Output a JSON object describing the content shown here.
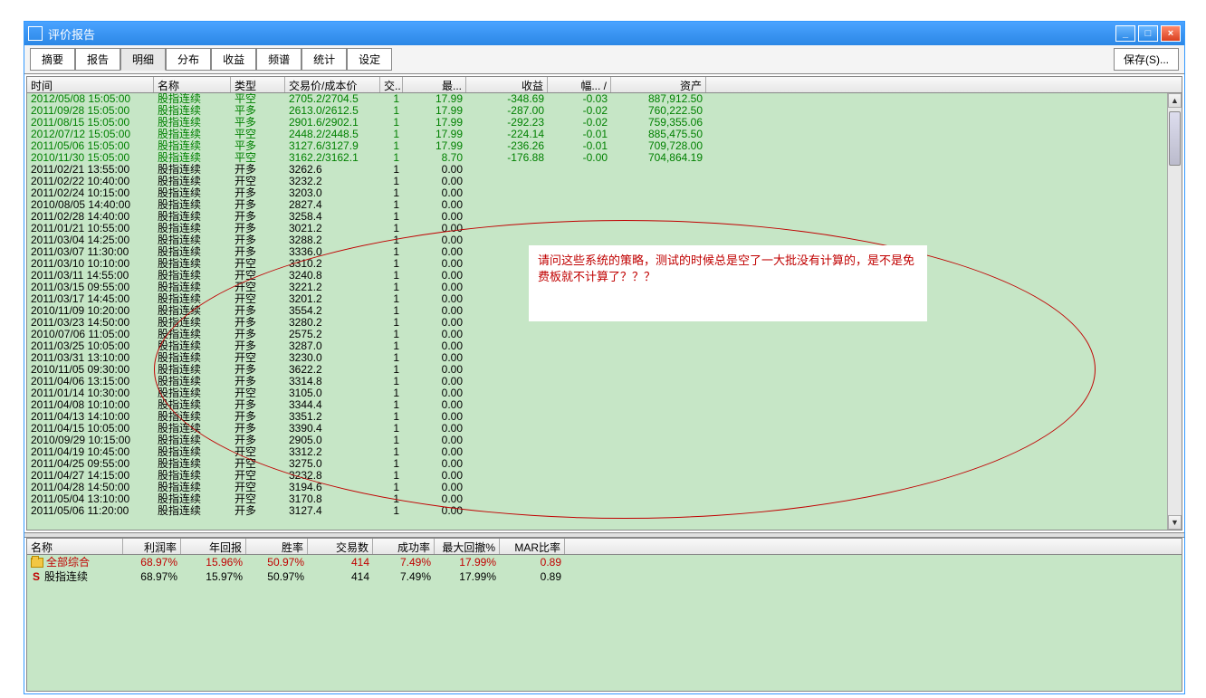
{
  "titlebar": {
    "title": "评价报告",
    "min": "_",
    "max": "□",
    "close": "×"
  },
  "toolbar": {
    "tabs": [
      "摘要",
      "报告",
      "明细",
      "分布",
      "收益",
      "频谱",
      "统计",
      "设定"
    ],
    "active_index": 2,
    "save_label": "保存(S)..."
  },
  "main_columns": [
    "时间",
    "名称",
    "类型",
    "交易价/成本价",
    "交..",
    "最...",
    "收益",
    "幅...  /",
    "资产"
  ],
  "main_rows": [
    {
      "g": 1,
      "t": "2012/05/08 15:05:00",
      "n": "股指连续",
      "ty": "平空",
      "p": "2705.2/2704.5",
      "q": "1",
      "a": "17.99",
      "pr": "-348.69",
      "r": "-0.03",
      "as": "887,912.50"
    },
    {
      "g": 1,
      "t": "2011/09/28 15:05:00",
      "n": "股指连续",
      "ty": "平多",
      "p": "2613.0/2612.5",
      "q": "1",
      "a": "17.99",
      "pr": "-287.00",
      "r": "-0.02",
      "as": "760,222.50"
    },
    {
      "g": 1,
      "t": "2011/08/15 15:05:00",
      "n": "股指连续",
      "ty": "平多",
      "p": "2901.6/2902.1",
      "q": "1",
      "a": "17.99",
      "pr": "-292.23",
      "r": "-0.02",
      "as": "759,355.06"
    },
    {
      "g": 1,
      "t": "2012/07/12 15:05:00",
      "n": "股指连续",
      "ty": "平空",
      "p": "2448.2/2448.5",
      "q": "1",
      "a": "17.99",
      "pr": "-224.14",
      "r": "-0.01",
      "as": "885,475.50"
    },
    {
      "g": 1,
      "t": "2011/05/06 15:05:00",
      "n": "股指连续",
      "ty": "平多",
      "p": "3127.6/3127.9",
      "q": "1",
      "a": "17.99",
      "pr": "-236.26",
      "r": "-0.01",
      "as": "709,728.00"
    },
    {
      "g": 1,
      "t": "2010/11/30 15:05:00",
      "n": "股指连续",
      "ty": "平空",
      "p": "3162.2/3162.1",
      "q": "1",
      "a": "8.70",
      "pr": "-176.88",
      "r": "-0.00",
      "as": "704,864.19"
    },
    {
      "g": 0,
      "t": "2011/02/21 13:55:00",
      "n": "股指连续",
      "ty": "开多",
      "p": "3262.6",
      "q": "1",
      "a": "0.00",
      "pr": "",
      "r": "",
      "as": ""
    },
    {
      "g": 0,
      "t": "2011/02/22 10:40:00",
      "n": "股指连续",
      "ty": "开空",
      "p": "3232.2",
      "q": "1",
      "a": "0.00",
      "pr": "",
      "r": "",
      "as": ""
    },
    {
      "g": 0,
      "t": "2011/02/24 10:15:00",
      "n": "股指连续",
      "ty": "开多",
      "p": "3203.0",
      "q": "1",
      "a": "0.00",
      "pr": "",
      "r": "",
      "as": ""
    },
    {
      "g": 0,
      "t": "2010/08/05 14:40:00",
      "n": "股指连续",
      "ty": "开多",
      "p": "2827.4",
      "q": "1",
      "a": "0.00",
      "pr": "",
      "r": "",
      "as": ""
    },
    {
      "g": 0,
      "t": "2011/02/28 14:40:00",
      "n": "股指连续",
      "ty": "开多",
      "p": "3258.4",
      "q": "1",
      "a": "0.00",
      "pr": "",
      "r": "",
      "as": ""
    },
    {
      "g": 0,
      "t": "2011/01/21 10:55:00",
      "n": "股指连续",
      "ty": "开多",
      "p": "3021.2",
      "q": "1",
      "a": "0.00",
      "pr": "",
      "r": "",
      "as": ""
    },
    {
      "g": 0,
      "t": "2011/03/04 14:25:00",
      "n": "股指连续",
      "ty": "开多",
      "p": "3288.2",
      "q": "1",
      "a": "0.00",
      "pr": "",
      "r": "",
      "as": ""
    },
    {
      "g": 0,
      "t": "2011/03/07 11:30:00",
      "n": "股指连续",
      "ty": "开多",
      "p": "3336.0",
      "q": "1",
      "a": "0.00",
      "pr": "",
      "r": "",
      "as": ""
    },
    {
      "g": 0,
      "t": "2011/03/10 10:10:00",
      "n": "股指连续",
      "ty": "开空",
      "p": "3310.2",
      "q": "1",
      "a": "0.00",
      "pr": "",
      "r": "",
      "as": ""
    },
    {
      "g": 0,
      "t": "2011/03/11 14:55:00",
      "n": "股指连续",
      "ty": "开空",
      "p": "3240.8",
      "q": "1",
      "a": "0.00",
      "pr": "",
      "r": "",
      "as": ""
    },
    {
      "g": 0,
      "t": "2011/03/15 09:55:00",
      "n": "股指连续",
      "ty": "开空",
      "p": "3221.2",
      "q": "1",
      "a": "0.00",
      "pr": "",
      "r": "",
      "as": ""
    },
    {
      "g": 0,
      "t": "2011/03/17 14:45:00",
      "n": "股指连续",
      "ty": "开空",
      "p": "3201.2",
      "q": "1",
      "a": "0.00",
      "pr": "",
      "r": "",
      "as": ""
    },
    {
      "g": 0,
      "t": "2010/11/09 10:20:00",
      "n": "股指连续",
      "ty": "开多",
      "p": "3554.2",
      "q": "1",
      "a": "0.00",
      "pr": "",
      "r": "",
      "as": ""
    },
    {
      "g": 0,
      "t": "2011/03/23 14:50:00",
      "n": "股指连续",
      "ty": "开多",
      "p": "3280.2",
      "q": "1",
      "a": "0.00",
      "pr": "",
      "r": "",
      "as": ""
    },
    {
      "g": 0,
      "t": "2010/07/06 11:05:00",
      "n": "股指连续",
      "ty": "开多",
      "p": "2575.2",
      "q": "1",
      "a": "0.00",
      "pr": "",
      "r": "",
      "as": ""
    },
    {
      "g": 0,
      "t": "2011/03/25 10:05:00",
      "n": "股指连续",
      "ty": "开多",
      "p": "3287.0",
      "q": "1",
      "a": "0.00",
      "pr": "",
      "r": "",
      "as": ""
    },
    {
      "g": 0,
      "t": "2011/03/31 13:10:00",
      "n": "股指连续",
      "ty": "开空",
      "p": "3230.0",
      "q": "1",
      "a": "0.00",
      "pr": "",
      "r": "",
      "as": ""
    },
    {
      "g": 0,
      "t": "2010/11/05 09:30:00",
      "n": "股指连续",
      "ty": "开多",
      "p": "3622.2",
      "q": "1",
      "a": "0.00",
      "pr": "",
      "r": "",
      "as": ""
    },
    {
      "g": 0,
      "t": "2011/04/06 13:15:00",
      "n": "股指连续",
      "ty": "开多",
      "p": "3314.8",
      "q": "1",
      "a": "0.00",
      "pr": "",
      "r": "",
      "as": ""
    },
    {
      "g": 0,
      "t": "2011/01/14 10:30:00",
      "n": "股指连续",
      "ty": "开空",
      "p": "3105.0",
      "q": "1",
      "a": "0.00",
      "pr": "",
      "r": "",
      "as": ""
    },
    {
      "g": 0,
      "t": "2011/04/08 10:10:00",
      "n": "股指连续",
      "ty": "开多",
      "p": "3344.4",
      "q": "1",
      "a": "0.00",
      "pr": "",
      "r": "",
      "as": ""
    },
    {
      "g": 0,
      "t": "2011/04/13 14:10:00",
      "n": "股指连续",
      "ty": "开多",
      "p": "3351.2",
      "q": "1",
      "a": "0.00",
      "pr": "",
      "r": "",
      "as": ""
    },
    {
      "g": 0,
      "t": "2011/04/15 10:05:00",
      "n": "股指连续",
      "ty": "开多",
      "p": "3390.4",
      "q": "1",
      "a": "0.00",
      "pr": "",
      "r": "",
      "as": ""
    },
    {
      "g": 0,
      "t": "2010/09/29 10:15:00",
      "n": "股指连续",
      "ty": "开多",
      "p": "2905.0",
      "q": "1",
      "a": "0.00",
      "pr": "",
      "r": "",
      "as": ""
    },
    {
      "g": 0,
      "t": "2011/04/19 10:45:00",
      "n": "股指连续",
      "ty": "开空",
      "p": "3312.2",
      "q": "1",
      "a": "0.00",
      "pr": "",
      "r": "",
      "as": ""
    },
    {
      "g": 0,
      "t": "2011/04/25 09:55:00",
      "n": "股指连续",
      "ty": "开空",
      "p": "3275.0",
      "q": "1",
      "a": "0.00",
      "pr": "",
      "r": "",
      "as": ""
    },
    {
      "g": 0,
      "t": "2011/04/27 14:15:00",
      "n": "股指连续",
      "ty": "开空",
      "p": "3232.8",
      "q": "1",
      "a": "0.00",
      "pr": "",
      "r": "",
      "as": ""
    },
    {
      "g": 0,
      "t": "2011/04/28 14:50:00",
      "n": "股指连续",
      "ty": "开空",
      "p": "3194.6",
      "q": "1",
      "a": "0.00",
      "pr": "",
      "r": "",
      "as": ""
    },
    {
      "g": 0,
      "t": "2011/05/04 13:10:00",
      "n": "股指连续",
      "ty": "开空",
      "p": "3170.8",
      "q": "1",
      "a": "0.00",
      "pr": "",
      "r": "",
      "as": ""
    },
    {
      "g": 0,
      "t": "2011/05/06 11:20:00",
      "n": "股指连续",
      "ty": "开多",
      "p": "3127.4",
      "q": "1",
      "a": "0.00",
      "pr": "",
      "r": "",
      "as": ""
    }
  ],
  "overlay": {
    "text": "请问这些系统的策略，测试的时候总是空了一大批没有计算的，是不是免费板就不计算了？？？"
  },
  "summary_columns": [
    "名称",
    "利润率",
    "年回报",
    "胜率",
    "交易数",
    "成功率",
    "最大回撤%",
    "MAR比率"
  ],
  "summary_rows": [
    {
      "icon": "folder",
      "name": "全部综合",
      "profit": "68.97%",
      "year": "15.96%",
      "win": "50.97%",
      "trades": "414",
      "succ": "7.49%",
      "dd": "17.99%",
      "mar": "0.89",
      "color": "red"
    },
    {
      "icon": "S",
      "name": "股指连续",
      "profit": "68.97%",
      "year": "15.97%",
      "win": "50.97%",
      "trades": "414",
      "succ": "7.49%",
      "dd": "17.99%",
      "mar": "0.89",
      "color": "black"
    }
  ]
}
